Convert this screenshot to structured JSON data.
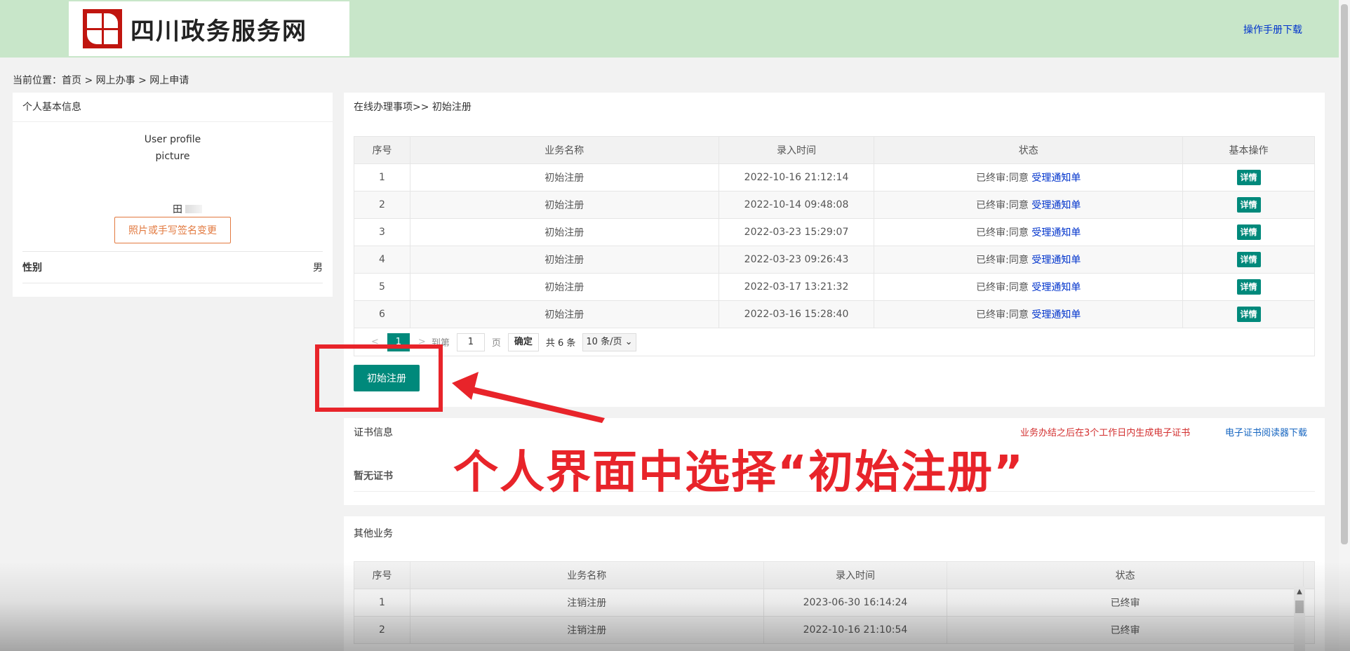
{
  "header": {
    "site_name": "四川政务服务网",
    "manual_link": "操作手册下载",
    "colors": {
      "header_bg": "#c8e6c9",
      "seal": "#c0150f"
    }
  },
  "breadcrumb": "当前位置：首页 > 网上办事 > 网上申请",
  "profile": {
    "title": "个人基本信息",
    "picture_alt_line1": "User profile",
    "picture_alt_line2": "picture",
    "name_visible": "田",
    "signature_button": "照片或手写签名变更",
    "gender_label": "性别",
    "gender_value": "男"
  },
  "online": {
    "title": "在线办理事项>> 初始注册",
    "columns": [
      "序号",
      "业务名称",
      "录入时间",
      "状态",
      "基本操作"
    ],
    "rows": [
      {
        "no": "1",
        "name": "初始注册",
        "time": "2022-10-16 21:12:14",
        "status": "已终审:同意",
        "link": "受理通知单",
        "action": "详情"
      },
      {
        "no": "2",
        "name": "初始注册",
        "time": "2022-10-14 09:48:08",
        "status": "已终审:同意",
        "link": "受理通知单",
        "action": "详情"
      },
      {
        "no": "3",
        "name": "初始注册",
        "time": "2022-03-23 15:29:07",
        "status": "已终审:同意",
        "link": "受理通知单",
        "action": "详情"
      },
      {
        "no": "4",
        "name": "初始注册",
        "time": "2022-03-23 09:26:43",
        "status": "已终审:同意",
        "link": "受理通知单",
        "action": "详情"
      },
      {
        "no": "5",
        "name": "初始注册",
        "time": "2022-03-17 13:21:32",
        "status": "已终审:同意",
        "link": "受理通知单",
        "action": "详情"
      },
      {
        "no": "6",
        "name": "初始注册",
        "time": "2022-03-16 15:28:40",
        "status": "已终审:同意",
        "link": "受理通知单",
        "action": "详情"
      }
    ],
    "pager": {
      "prev": "<",
      "current": "1",
      "next": ">",
      "goto_label": "到第",
      "page_input": "1",
      "page_unit": "页",
      "confirm": "确定",
      "total": "共 6 条",
      "page_size": "10 条/页"
    },
    "register_button": "初始注册"
  },
  "certificate": {
    "title": "证书信息",
    "note": "业务办结之后在3个工作日内生成电子证书",
    "reader_download": "电子证书阅读器下载",
    "empty": "暂无证书"
  },
  "other": {
    "title": "其他业务",
    "columns": [
      "序号",
      "业务名称",
      "录入时间",
      "状态"
    ],
    "rows": [
      {
        "no": "1",
        "name": "注销注册",
        "time": "2023-06-30 16:14:24",
        "status": "已终审"
      },
      {
        "no": "2",
        "name": "注销注册",
        "time": "2022-10-16 21:10:54",
        "status": "已终审"
      }
    ]
  },
  "annotation": {
    "text": "个人界面中选择“初始注册”",
    "color": "#e8242a"
  }
}
